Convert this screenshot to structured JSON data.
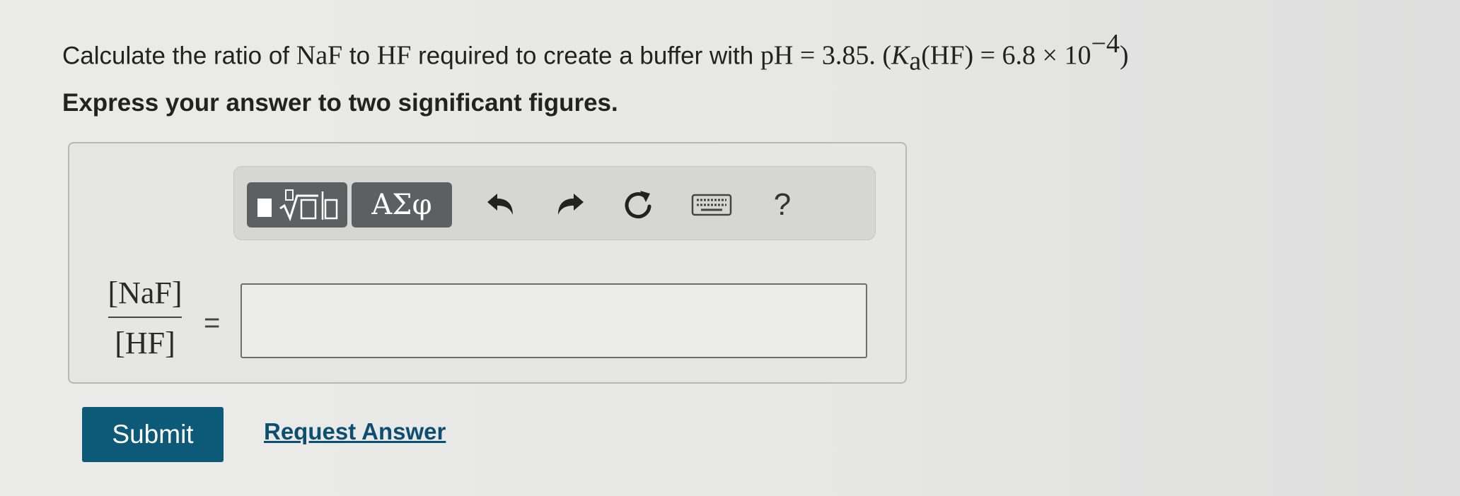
{
  "question": {
    "prefix": "Calculate the ratio of ",
    "salt": "NaF",
    "middle1": " to ",
    "acid": "HF",
    "middle2": " required to create a buffer with ",
    "ph_expr": "pH = 3.85. (",
    "ka_symbol": "K",
    "ka_sub": "a",
    "ka_expr": "(HF) = 6.8 × 10",
    "exponent": "−4",
    "close": ")"
  },
  "instruction": "Express your answer to two significant figures.",
  "toolbar": {
    "greek_label": "ΑΣφ",
    "help_label": "?",
    "icons": [
      "templates-icon",
      "greek-symbols-icon",
      "undo-icon",
      "redo-icon",
      "reset-icon",
      "keyboard-icon",
      "help-icon"
    ]
  },
  "answer": {
    "numerator": "[NaF]",
    "denominator": "[HF]",
    "equals": "=",
    "value": ""
  },
  "actions": {
    "submit_label": "Submit",
    "request_label": "Request Answer"
  },
  "colors": {
    "submit_bg": "#0c5a78",
    "link": "#0d4f70",
    "toolbar_dark": "#5d5f61"
  }
}
